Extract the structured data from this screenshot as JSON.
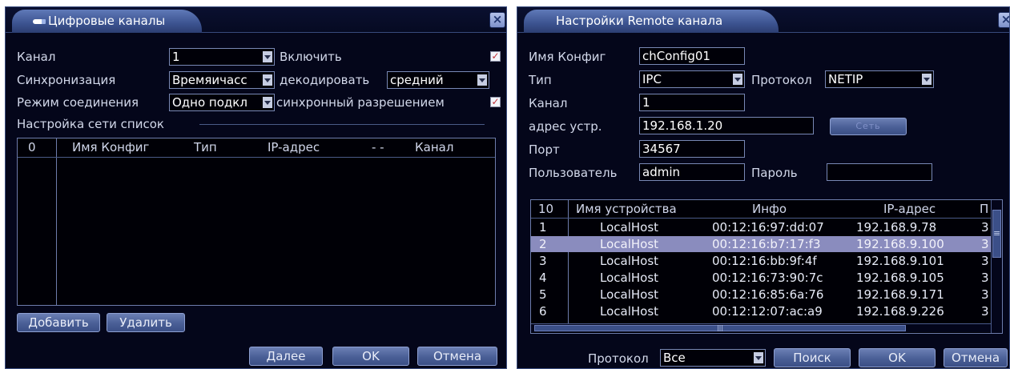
{
  "left_dialog": {
    "title": "Цифровые каналы",
    "channel_label": "Канал",
    "channel_value": "1",
    "enable_label": "Включить",
    "sync_label": "Синхронизация",
    "sync_value": "Времяичасс",
    "decode_label": "декодировать",
    "decode_value": "средний",
    "conn_mode_label": "Режим соединения",
    "conn_mode_value": "Одно подкл",
    "sync_res_label": "синхронный  разрешением",
    "net_list_label": "Настройка сети список",
    "table_headers": [
      "0",
      "Имя Конфиг",
      "Тип",
      "IP-адрес",
      "-  -",
      "Канал"
    ],
    "add_button": "Добавить",
    "delete_button": "Удалить",
    "next_button": "Далее",
    "ok_button": "OK",
    "cancel_button": "Отмена"
  },
  "right_dialog": {
    "title": "Настройки Remote канала",
    "config_name_label": "Имя Конфиг",
    "config_name_value": "chConfig01",
    "type_label": "Тип",
    "type_value": "IPC",
    "protocol_label": "Протокол",
    "protocol_value": "NETIP",
    "channel_label": "Канал",
    "channel_value": "1",
    "device_addr_label": "адрес устр.",
    "device_addr_value": "192.168.1.20",
    "net_button": "Сеть",
    "port_label": "Порт",
    "port_value": "34567",
    "user_label": "Пользователь",
    "user_value": "admin",
    "password_label": "Пароль",
    "password_value": "",
    "table_headers": [
      "10",
      "Имя устройства",
      "Инфо",
      "IP-адрес",
      "П"
    ],
    "rows": [
      {
        "num": "1",
        "name": "LocalHost",
        "info": "00:12:16:97:dd:07",
        "ip": "192.168.9.78",
        "extra": "3"
      },
      {
        "num": "2",
        "name": "LocalHost",
        "info": "00:12:16:b7:17:f3",
        "ip": "192.168.9.100",
        "extra": "3"
      },
      {
        "num": "3",
        "name": "LocalHost",
        "info": "00:12:16:bb:9f:4f",
        "ip": "192.168.9.101",
        "extra": "3"
      },
      {
        "num": "4",
        "name": "LocalHost",
        "info": "00:12:16:73:90:7c",
        "ip": "192.168.9.105",
        "extra": "3"
      },
      {
        "num": "5",
        "name": "LocalHost",
        "info": "00:12:16:85:6a:76",
        "ip": "192.168.9.171",
        "extra": "3"
      },
      {
        "num": "6",
        "name": "LocalHost",
        "info": "00:12:12:07:ac:a9",
        "ip": "192.168.9.226",
        "extra": "3"
      }
    ],
    "selected_row_index": 1,
    "bottom_protocol_label": "Протокол",
    "bottom_protocol_value": "Все",
    "search_button": "Поиск",
    "ok_button": "OK",
    "cancel_button": "Отмена"
  },
  "colors": {
    "background": "#04061a",
    "tab": "#4a62a4",
    "selection": "#8a8cbe",
    "button": "#4a5f96"
  }
}
